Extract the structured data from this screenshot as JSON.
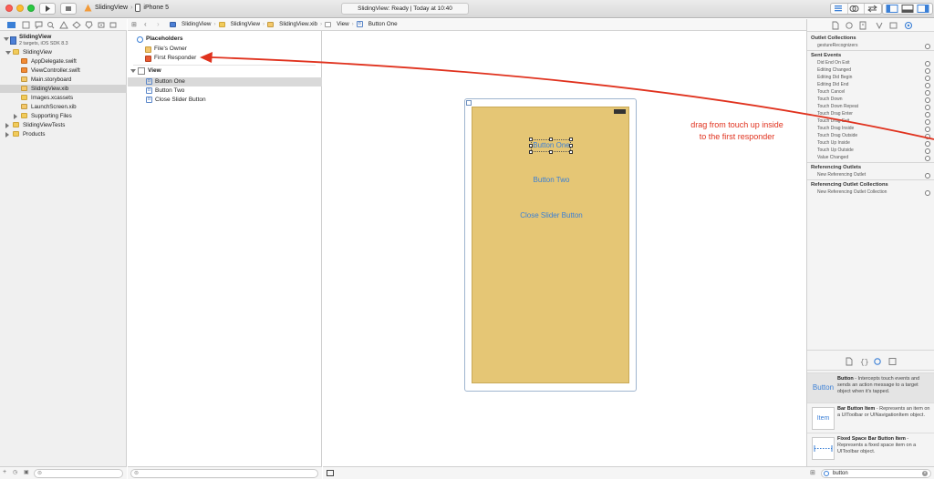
{
  "toolbar": {
    "scheme_name": "SlidingView",
    "device_name": "iPhone 5",
    "activity_status": "SlidingView: Ready  |  Today at 10:40"
  },
  "jumpbar": {
    "crumbs": [
      "SlidingView",
      "SlidingView",
      "SlidingView.xib",
      "View",
      "Button One"
    ]
  },
  "navigator": {
    "project_name": "SlidingView",
    "project_sub": "2 targets, iOS SDK 8.3",
    "items": [
      {
        "label": "SlidingView",
        "kind": "folder",
        "indent": 1,
        "open": true
      },
      {
        "label": "AppDelegate.swift",
        "kind": "swift",
        "indent": 2
      },
      {
        "label": "ViewController.swift",
        "kind": "swift",
        "indent": 2
      },
      {
        "label": "Main.storyboard",
        "kind": "xib",
        "indent": 2
      },
      {
        "label": "SlidingView.xib",
        "kind": "xib",
        "indent": 2,
        "selected": true
      },
      {
        "label": "Images.xcassets",
        "kind": "folder",
        "indent": 2
      },
      {
        "label": "LaunchScreen.xib",
        "kind": "xib",
        "indent": 2
      },
      {
        "label": "Supporting Files",
        "kind": "folder",
        "indent": 2,
        "open": false
      },
      {
        "label": "SlidingViewTests",
        "kind": "folder",
        "indent": 1,
        "open": false
      },
      {
        "label": "Products",
        "kind": "folder",
        "indent": 1,
        "open": false
      }
    ]
  },
  "outline": {
    "placeholders_header": "Placeholders",
    "files_owner": "File's Owner",
    "first_responder": "First Responder",
    "view_header": "View",
    "children": [
      "Button One",
      "Button Two",
      "Close Slider Button"
    ]
  },
  "canvas": {
    "button_one": "Button One",
    "button_two": "Button Two",
    "close_button": "Close Slider Button",
    "annotation_line1": "drag from touch up inside",
    "annotation_line2": "to the first responder",
    "annotation_color": "#e0321e"
  },
  "inspector": {
    "outlet_collections_header": "Outlet Collections",
    "outlet_collections": [
      "gestureRecognizers"
    ],
    "sent_events_header": "Sent Events",
    "sent_events": [
      "Did End On Exit",
      "Editing Changed",
      "Editing Did Begin",
      "Editing Did End",
      "Touch Cancel",
      "Touch Down",
      "Touch Down Repeat",
      "Touch Drag Enter",
      "Touch Drag Exit",
      "Touch Drag Inside",
      "Touch Drag Outside",
      "Touch Up Inside",
      "Touch Up Outside",
      "Value Changed"
    ],
    "referencing_outlets_header": "Referencing Outlets",
    "new_referencing_outlet": "New Referencing Outlet",
    "referencing_outlet_collections_header": "Referencing Outlet Collections",
    "new_referencing_outlet_collection": "New Referencing Outlet Collection"
  },
  "library": {
    "items": [
      {
        "icon_text": "Button",
        "title": "Button",
        "desc": " - Intercepts touch events and sends an action message to a target object when it's tapped."
      },
      {
        "icon_text": "Item",
        "title": "Bar Button Item",
        "desc": " - Represents an item on a UIToolbar or UINavigationItem object."
      },
      {
        "icon_text": "",
        "title": "Fixed Space Bar Button Item",
        "desc": " - Represents a fixed space item on a UIToolbar object."
      }
    ],
    "search_value": "button"
  }
}
